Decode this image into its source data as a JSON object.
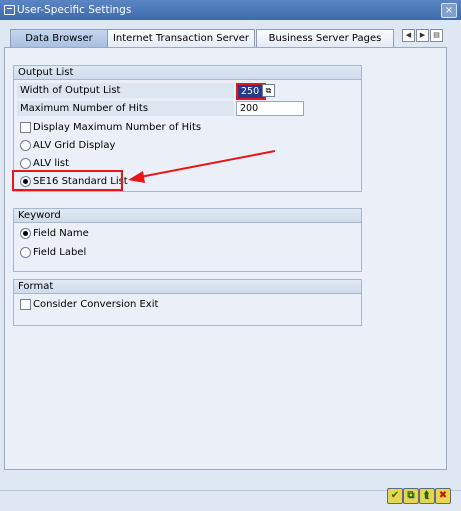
{
  "window": {
    "title": "User-Specific Settings",
    "close_glyph": "×"
  },
  "tabs": [
    {
      "label": "Data Browser",
      "active": true
    },
    {
      "label": "Internet Transaction Server",
      "active": false
    },
    {
      "label": "Business Server Pages",
      "active": false
    }
  ],
  "tab_nav": {
    "prev_glyph": "◀",
    "next_glyph": "▶",
    "list_glyph": "▤"
  },
  "output_list": {
    "title": "Output List",
    "width_label": "Width of Output List",
    "width_value": "250",
    "max_hits_label": "Maximum Number of Hits",
    "max_hits_value": "200",
    "display_max_label": "Display Maximum Number of Hits",
    "display_max_checked": false,
    "options": [
      {
        "label": "ALV Grid Display",
        "selected": false
      },
      {
        "label": "ALV list",
        "selected": false
      },
      {
        "label": "SE16 Standard List",
        "selected": true
      }
    ]
  },
  "keyword": {
    "title": "Keyword",
    "options": [
      {
        "label": "Field Name",
        "selected": true
      },
      {
        "label": "Field Label",
        "selected": false
      }
    ]
  },
  "format": {
    "title": "Format",
    "conversion_label": "Consider Conversion Exit",
    "conversion_checked": false
  },
  "annotation": {
    "color": "#e8161b"
  },
  "footer": {
    "confirm_glyph": "✔",
    "copy_glyph": "⧉",
    "save_glyph": "⮬",
    "cancel_glyph": "✖"
  }
}
